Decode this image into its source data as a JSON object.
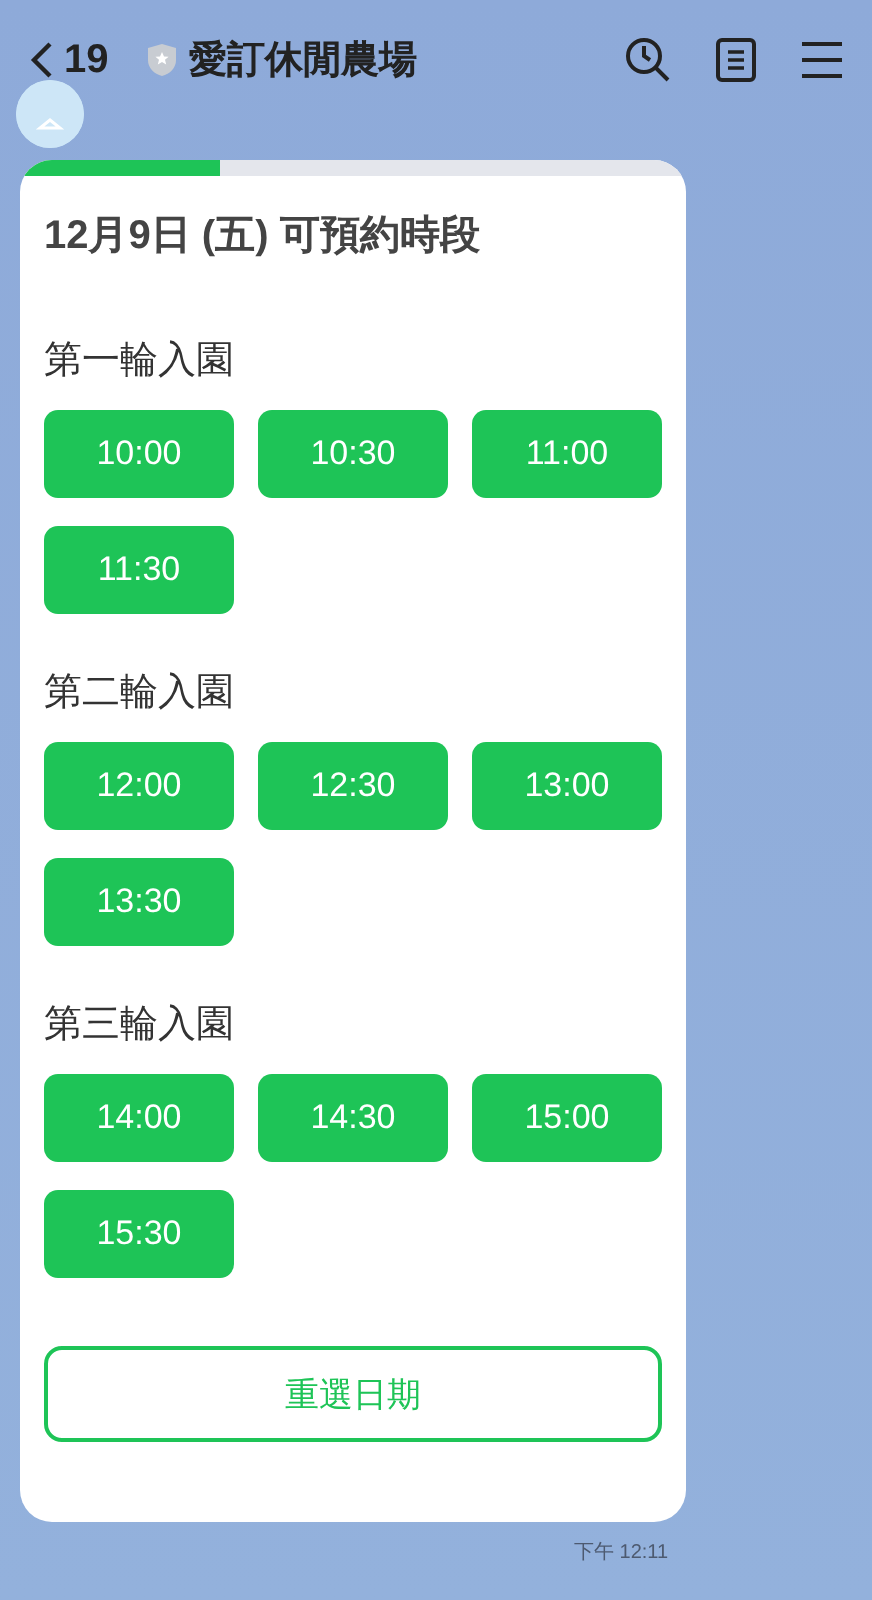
{
  "header": {
    "back_count": "19",
    "title": "愛訂休閒農場"
  },
  "card": {
    "progress": {
      "level": 0.3
    },
    "title": "12月9日 (五) 可預約時段",
    "sections": [
      {
        "label": "第一輪入園",
        "slots": [
          "10:00",
          "10:30",
          "11:00",
          "11:30"
        ]
      },
      {
        "label": "第二輪入園",
        "slots": [
          "12:00",
          "12:30",
          "13:00",
          "13:30"
        ]
      },
      {
        "label": "第三輪入園",
        "slots": [
          "14:00",
          "14:30",
          "15:00",
          "15:30"
        ]
      }
    ],
    "reselect_button": "重選日期"
  },
  "timestamp": "下午 12:11"
}
